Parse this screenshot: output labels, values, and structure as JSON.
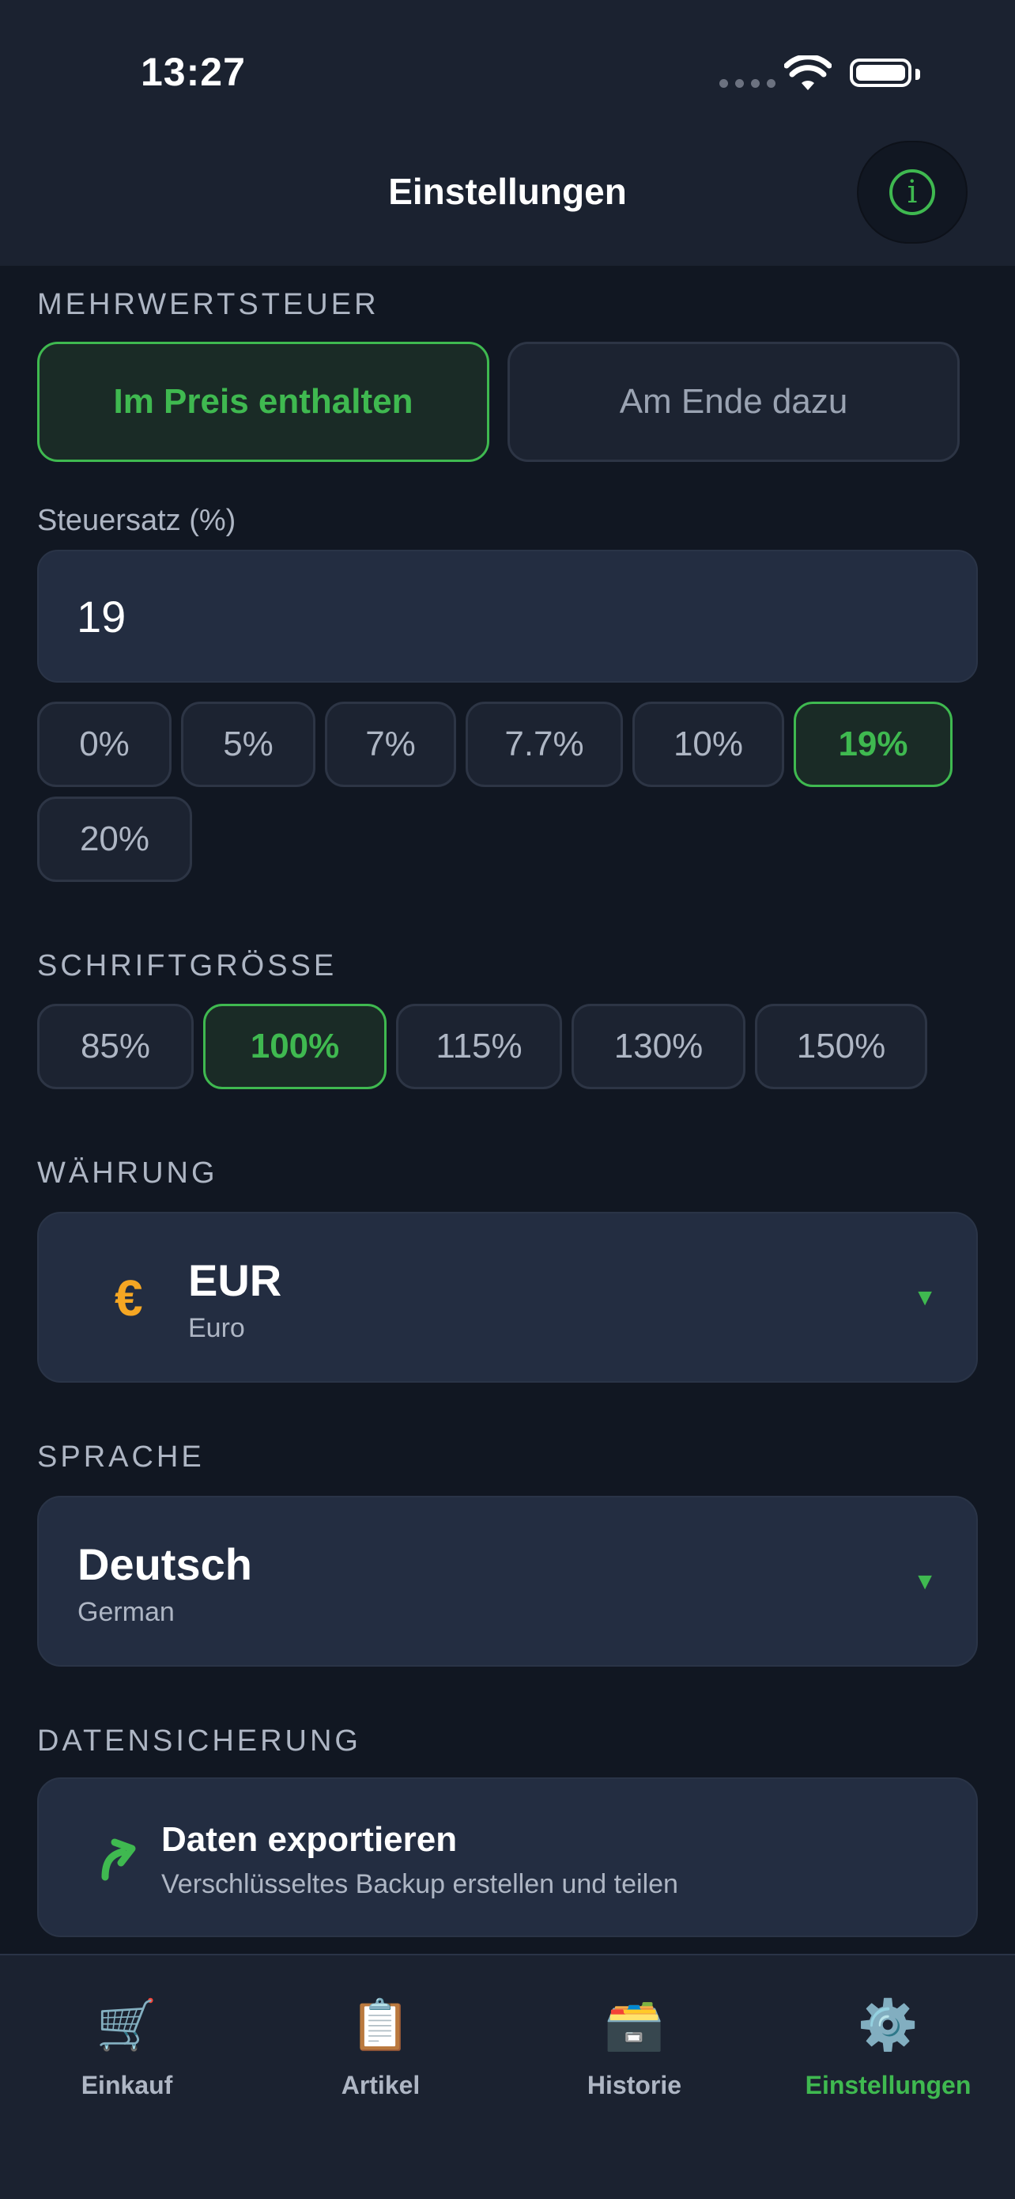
{
  "status_bar": {
    "time": "13:27"
  },
  "header": {
    "title": "Einstellungen",
    "info_icon": "i"
  },
  "vat": {
    "section": "MEHRWERTSTEUER",
    "options": [
      "Im Preis enthalten",
      "Am Ende dazu"
    ],
    "selected": "Im Preis enthalten"
  },
  "tax_rate": {
    "label": "Steuersatz (%)",
    "value": "19",
    "presets": [
      "0%",
      "5%",
      "7%",
      "7.7%",
      "10%",
      "19%",
      "20%"
    ],
    "selected": "19%"
  },
  "font_size": {
    "section": "SCHRIFTGRÖSSE",
    "options": [
      "85%",
      "100%",
      "115%",
      "130%",
      "150%"
    ],
    "selected": "100%"
  },
  "currency": {
    "section": "WÄHRUNG",
    "symbol": "€",
    "code": "EUR",
    "name": "Euro",
    "caret": "▼"
  },
  "language": {
    "section": "SPRACHE",
    "name": "Deutsch",
    "english": "German",
    "caret": "▼"
  },
  "backup": {
    "section": "DATENSICHERUNG",
    "export_title": "Daten exportieren",
    "export_subtitle": "Verschlüsseltes Backup erstellen und teilen"
  },
  "tabbar": {
    "tabs": [
      {
        "label": "Einkauf",
        "icon": "🛒",
        "icon_name": "shopping-cart-icon"
      },
      {
        "label": "Artikel",
        "icon": "📋",
        "icon_name": "clipboard-icon"
      },
      {
        "label": "Historie",
        "icon": "🗃️",
        "icon_name": "archive-box-icon"
      },
      {
        "label": "Einstellungen",
        "icon": "⚙️",
        "icon_name": "gear-icon"
      }
    ],
    "active": "Einstellungen"
  },
  "colors": {
    "accent": "#3fb950",
    "background": "#111722",
    "card": "#232d41",
    "currency_icon": "#f5a623"
  }
}
